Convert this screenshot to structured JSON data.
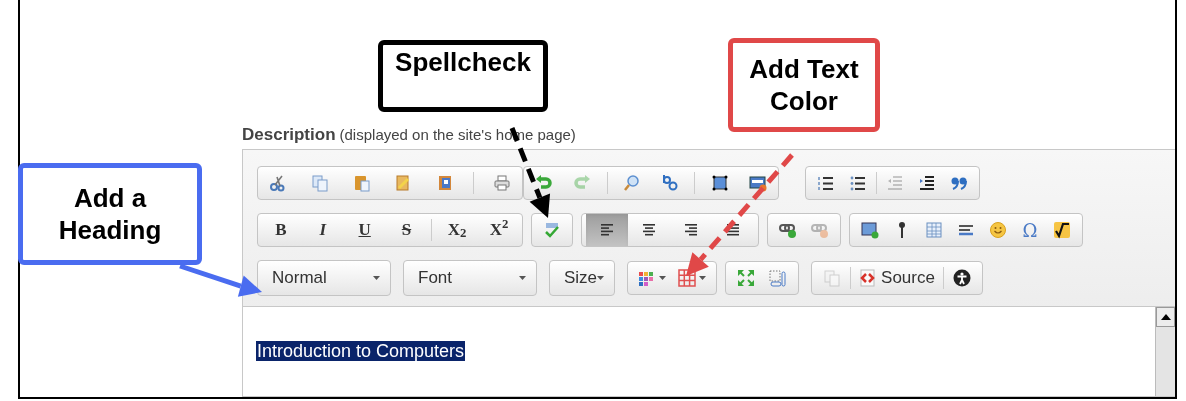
{
  "callouts": [
    {
      "text": "Spellcheck",
      "color": "#000000"
    },
    {
      "text": "Add Text Color",
      "color": "#e04848"
    },
    {
      "text": "Add a Heading",
      "color": "#4a6cf0"
    }
  ],
  "field": {
    "label": "Description",
    "hint": "(displayed on the site's home page)"
  },
  "toolbar": {
    "format_buttons": [
      {
        "label": "B"
      },
      {
        "label": "I"
      },
      {
        "label": "U"
      },
      {
        "label": "S"
      },
      {
        "label": "X$_{2}$"
      },
      {
        "label": "X$^{2}$"
      }
    ],
    "redo_disabled": true,
    "unlink_disabled": true,
    "outdent_disabled": true,
    "copy_format_disabled": true,
    "alignment": [
      {
        "selected": true
      },
      {
        "selected": false
      },
      {
        "selected": false
      },
      {
        "selected": false
      }
    ],
    "special_char": "Ω",
    "combos": [
      {
        "label": "Normal"
      },
      {
        "label": "Font"
      },
      {
        "label": "Size"
      }
    ],
    "source_label": "Source"
  },
  "editor": {
    "text": "Introduction to Computers",
    "selected": true
  }
}
